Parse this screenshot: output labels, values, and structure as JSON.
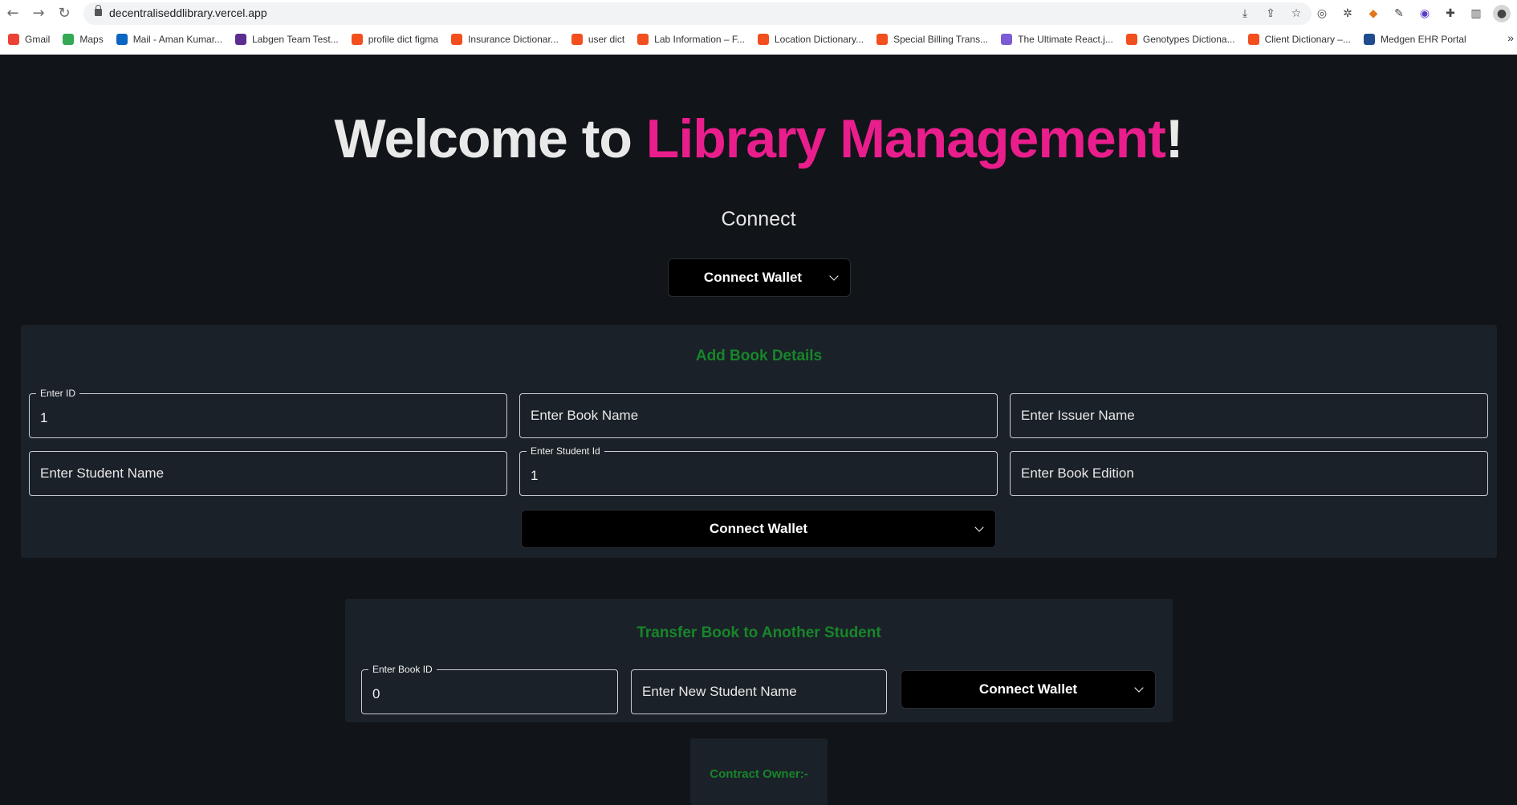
{
  "browser": {
    "url": "decentraliseddlibrary.vercel.app",
    "bookmarks": [
      {
        "label": "Gmail",
        "color": "#ea4335"
      },
      {
        "label": "Maps",
        "color": "#34a853"
      },
      {
        "label": "Mail - Aman Kumar...",
        "color": "#0a66c2"
      },
      {
        "label": "Labgen Team Test...",
        "color": "#5c2d91"
      },
      {
        "label": "profile dict figma",
        "color": "#f24e1e"
      },
      {
        "label": "Insurance Dictionar...",
        "color": "#f24e1e"
      },
      {
        "label": "user dict",
        "color": "#f24e1e"
      },
      {
        "label": "Lab Information – F...",
        "color": "#f24e1e"
      },
      {
        "label": "Location Dictionary...",
        "color": "#f24e1e"
      },
      {
        "label": "Special Billing Trans...",
        "color": "#f24e1e"
      },
      {
        "label": "The Ultimate React.j...",
        "color": "#7b5bd6"
      },
      {
        "label": "Genotypes Dictiona...",
        "color": "#f24e1e"
      },
      {
        "label": "Client Dictionary –...",
        "color": "#f24e1e"
      },
      {
        "label": "Medgen EHR Portal",
        "color": "#1e4c8c"
      }
    ],
    "more": "»"
  },
  "hero": {
    "prefix": "Welcome to ",
    "accent": "Library Management",
    "suffix": "!"
  },
  "connect": {
    "label": "Connect",
    "button": "Connect Wallet"
  },
  "add_book": {
    "title": "Add Book Details",
    "id_label": "Enter ID",
    "id_value": "1",
    "book_name_placeholder": "Enter Book Name",
    "issuer_placeholder": "Enter Issuer Name",
    "student_name_placeholder": "Enter Student Name",
    "student_id_label": "Enter Student Id",
    "student_id_value": "1",
    "edition_placeholder": "Enter Book Edition",
    "button": "Connect Wallet"
  },
  "transfer": {
    "title": "Transfer Book to Another Student",
    "book_id_label": "Enter Book ID",
    "book_id_value": "0",
    "new_student_placeholder": "Enter New Student Name",
    "button": "Connect Wallet"
  },
  "owner": {
    "label": "Contract Owner:-"
  },
  "colors": {
    "accent": "#e91e8c",
    "section_title": "#17852a",
    "background": "#111418",
    "panel": "#1b2128"
  }
}
